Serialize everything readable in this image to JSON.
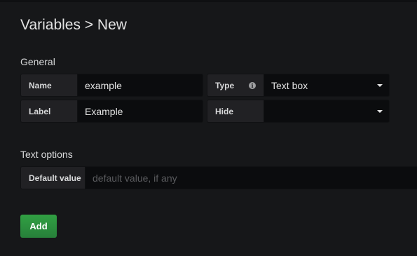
{
  "page": {
    "title": "Variables > New"
  },
  "general": {
    "section_title": "General",
    "name": {
      "label": "Name",
      "value": "example"
    },
    "type": {
      "label": "Type",
      "info_icon": "info-icon",
      "selected": "Text box"
    },
    "label": {
      "label": "Label",
      "value": "Example"
    },
    "hide": {
      "label": "Hide",
      "selected": ""
    }
  },
  "text_options": {
    "section_title": "Text options",
    "default_value": {
      "label": "Default value",
      "placeholder": "default value, if any",
      "value": ""
    }
  },
  "actions": {
    "add_label": "Add"
  },
  "colors": {
    "background": "#161719",
    "add_button": "#2d9140",
    "input_bg": "#0b0c0e",
    "label_bg": "#212124"
  }
}
